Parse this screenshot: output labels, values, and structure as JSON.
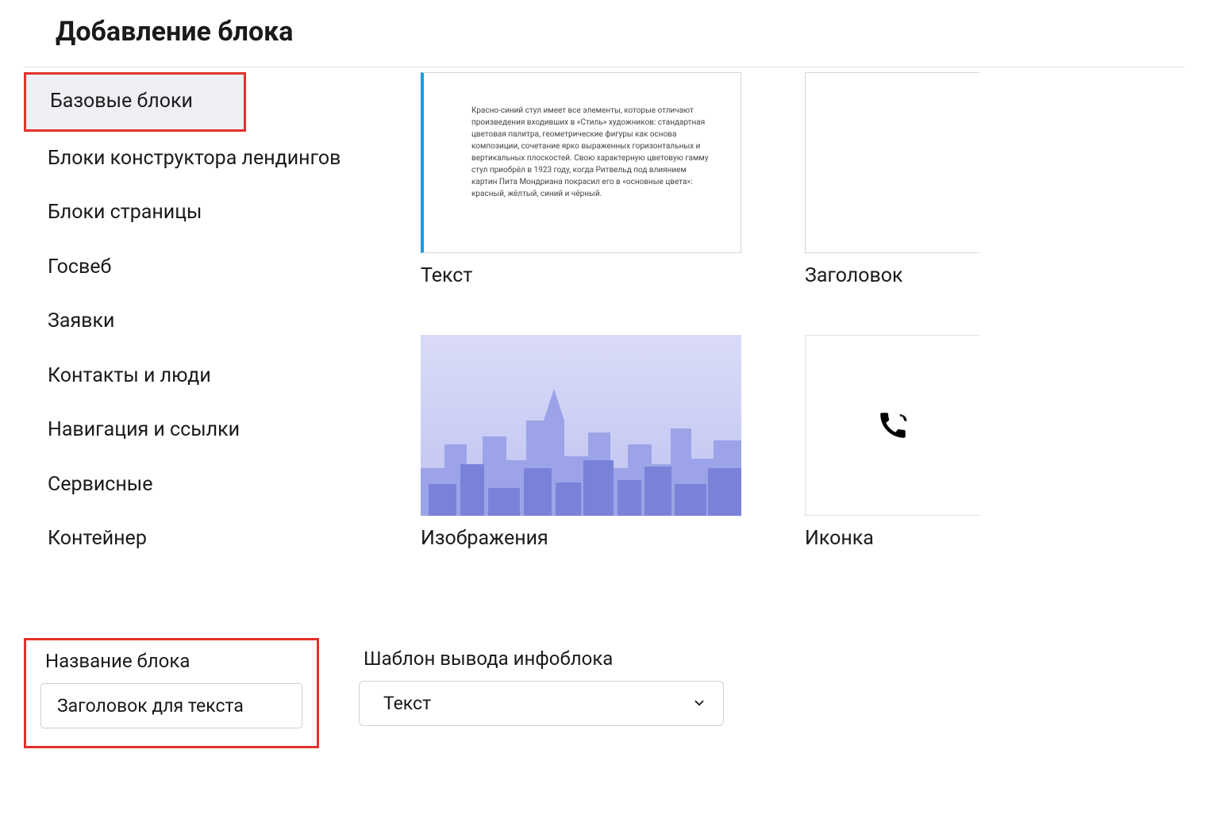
{
  "header": {
    "title": "Добавление блока"
  },
  "sidebar": {
    "items": [
      {
        "label": "Базовые блоки",
        "active": true,
        "highlighted": true
      },
      {
        "label": "Блоки конструктора лендингов"
      },
      {
        "label": "Блоки страницы"
      },
      {
        "label": "Госвеб"
      },
      {
        "label": "Заявки"
      },
      {
        "label": "Контакты и люди"
      },
      {
        "label": "Навигация и ссылки"
      },
      {
        "label": "Сервисные"
      },
      {
        "label": "Контейнер"
      }
    ]
  },
  "blocks": {
    "text": {
      "label": "Текст",
      "previewSample": "Красно-синий стул имеет все элементы, которые отличают произведения входивших в «Стиль» художников: стандартная цветовая палитра, геометрические фигуры как основа композиции, сочетание ярко выраженных горизонтальных и вертикальных плоскостей. Свою характерную цветовую гамму стул приобрёл в 1923 году, когда Ритвельд под влиянием картин Пита Мондриана покрасил его в «основные цвета»: красный, жёлтый, синий и чёрный."
    },
    "heading": {
      "label": "Заголовок"
    },
    "image": {
      "label": "Изображения"
    },
    "icon": {
      "label": "Иконка"
    }
  },
  "form": {
    "blockName": {
      "label": "Название блока",
      "value": "Заголовок для текста"
    },
    "template": {
      "label": "Шаблон вывода инфоблока",
      "value": "Текст"
    }
  }
}
